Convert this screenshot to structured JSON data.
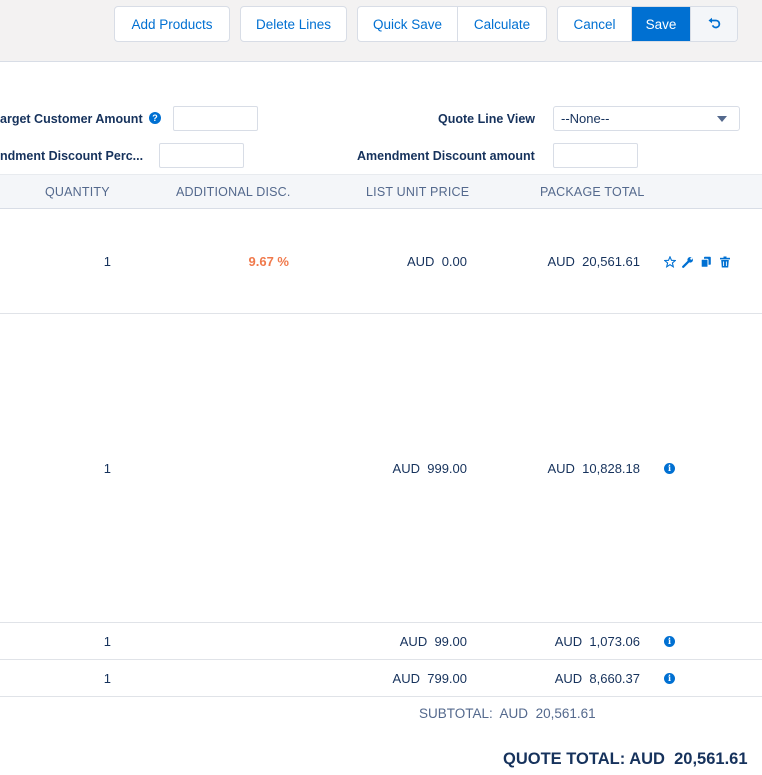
{
  "toolbar": {
    "add_products": "Add Products",
    "delete_lines": "Delete Lines",
    "quick_save": "Quick Save",
    "calculate": "Calculate",
    "cancel": "Cancel",
    "save": "Save"
  },
  "fields": {
    "target_customer_amount_label": "arget Customer Amount",
    "quote_line_view_label": "Quote Line View",
    "quote_line_view_value": "--None--",
    "amendment_discount_perc_label": "ndment Discount Perc...",
    "amendment_discount_amount_label": "Amendment Discount amount",
    "help_glyph": "?"
  },
  "table": {
    "headers": {
      "quantity": "QUANTITY",
      "additional_disc": "ADDITIONAL DISC.",
      "list_unit_price": "LIST UNIT PRICE",
      "package_total": "PACKAGE TOTAL"
    },
    "rows": [
      {
        "quantity": "1",
        "additional_disc": "9.67 %",
        "list_price_currency": "AUD",
        "list_price": "0.00",
        "package_currency": "AUD",
        "package_total": "20,561.61",
        "actions": [
          "star-icon",
          "wrench-icon",
          "copy-icon",
          "trash-icon"
        ]
      },
      {
        "quantity": "1",
        "additional_disc": "",
        "list_price_currency": "AUD",
        "list_price": "999.00",
        "package_currency": "AUD",
        "package_total": "10,828.18",
        "actions": [
          "info-icon"
        ]
      },
      {
        "quantity": "1",
        "additional_disc": "",
        "list_price_currency": "AUD",
        "list_price": "99.00",
        "package_currency": "AUD",
        "package_total": "1,073.06",
        "actions": [
          "info-icon"
        ]
      },
      {
        "quantity": "1",
        "additional_disc": "",
        "list_price_currency": "AUD",
        "list_price": "799.00",
        "package_currency": "AUD",
        "package_total": "8,660.37",
        "actions": [
          "info-icon"
        ]
      }
    ]
  },
  "totals": {
    "subtotal_label": "SUBTOTAL:",
    "subtotal_currency": "AUD",
    "subtotal_value": "20,561.61",
    "quote_total_label": "QUOTE TOTAL:",
    "quote_total_currency": "AUD",
    "quote_total_value": "20,561.61"
  },
  "colors": {
    "brand": "#0070d2",
    "discount": "#f0794b",
    "text": "#16325c"
  }
}
